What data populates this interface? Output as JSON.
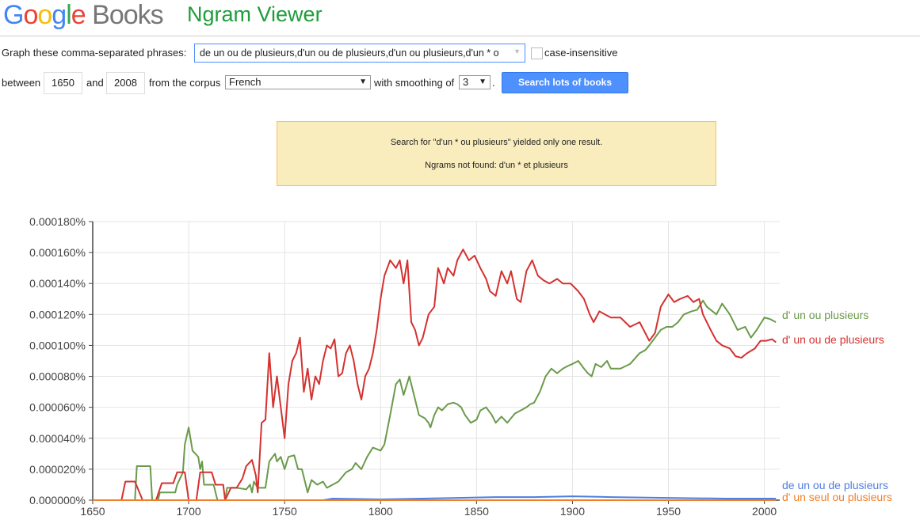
{
  "header": {
    "logo": "Google Books",
    "app_title": "Ngram Viewer"
  },
  "form": {
    "phrases_label": "Graph these comma-separated phrases:",
    "phrases_value": "de un ou de plusieurs,d'un ou de plusieurs,d'un ou plusieurs,d'un * o",
    "case_label": "case-insensitive",
    "case_checked": false,
    "between_label": "between",
    "start_year": "1650",
    "and_label": "and",
    "end_year": "2008",
    "corpus_label": "from the corpus",
    "corpus": "French",
    "smoothing_label": "with smoothing of",
    "smoothing": "3",
    "period": ".",
    "search_button": "Search lots of books"
  },
  "notice": {
    "line1": "Search for \"d'un * ou plusieurs\" yielded only one result.",
    "line2": "Ngrams not found: d'un * et plusieurs"
  },
  "chart_data": {
    "type": "line",
    "xlim": [
      1650,
      2008
    ],
    "ylim": [
      0,
      0.00018
    ],
    "x_ticks": [
      "1650",
      "1700",
      "1750",
      "1800",
      "1850",
      "1900",
      "1950",
      "2000"
    ],
    "y_ticks": [
      "0.000000%",
      "0.000020%",
      "0.000040%",
      "0.000060%",
      "0.000080%",
      "0.000100%",
      "0.000120%",
      "0.000140%",
      "0.000160%",
      "0.000180%"
    ],
    "grid": true,
    "legend": "right, at line ends",
    "series": [
      {
        "name": "d' un ou plusieurs",
        "color": "#6a9a4b",
        "points": [
          [
            1650,
            0
          ],
          [
            1672,
            0
          ],
          [
            1673,
            2.2e-05
          ],
          [
            1680,
            2.2e-05
          ],
          [
            1681,
            0
          ],
          [
            1684,
            0
          ],
          [
            1685,
            5e-06
          ],
          [
            1693,
            5e-06
          ],
          [
            1694,
            1e-05
          ],
          [
            1697,
            1.8e-05
          ],
          [
            1698,
            3.6e-05
          ],
          [
            1700,
            4.7e-05
          ],
          [
            1702,
            3.2e-05
          ],
          [
            1705,
            2.8e-05
          ],
          [
            1706,
            2e-05
          ],
          [
            1707,
            2.5e-05
          ],
          [
            1708,
            1e-05
          ],
          [
            1713,
            1e-05
          ],
          [
            1715,
            0
          ],
          [
            1719,
            0
          ],
          [
            1720,
            8e-06
          ],
          [
            1725,
            8e-06
          ],
          [
            1730,
            7e-06
          ],
          [
            1732,
            1e-05
          ],
          [
            1733,
            5e-06
          ],
          [
            1734,
            1.2e-05
          ],
          [
            1736,
            8e-06
          ],
          [
            1740,
            8e-06
          ],
          [
            1742,
            2.5e-05
          ],
          [
            1745,
            3e-05
          ],
          [
            1746,
            2.5e-05
          ],
          [
            1748,
            2.8e-05
          ],
          [
            1750,
            2e-05
          ],
          [
            1752,
            2.8e-05
          ],
          [
            1755,
            2.9e-05
          ],
          [
            1757,
            2e-05
          ],
          [
            1759,
            2e-05
          ],
          [
            1762,
            5e-06
          ],
          [
            1764,
            1.3e-05
          ],
          [
            1767,
            1e-05
          ],
          [
            1770,
            1.2e-05
          ],
          [
            1772,
            8e-06
          ],
          [
            1775,
            1e-05
          ],
          [
            1778,
            1.2e-05
          ],
          [
            1782,
            1.8e-05
          ],
          [
            1785,
            2e-05
          ],
          [
            1787,
            2.4e-05
          ],
          [
            1790,
            2e-05
          ],
          [
            1793,
            2.8e-05
          ],
          [
            1796,
            3.4e-05
          ],
          [
            1798,
            3.3e-05
          ],
          [
            1800,
            3.2e-05
          ],
          [
            1802,
            3.6e-05
          ],
          [
            1805,
            5.5e-05
          ],
          [
            1808,
            7.5e-05
          ],
          [
            1810,
            7.8e-05
          ],
          [
            1812,
            6.8e-05
          ],
          [
            1815,
            8e-05
          ],
          [
            1817,
            7e-05
          ],
          [
            1820,
            5.5e-05
          ],
          [
            1823,
            5.3e-05
          ],
          [
            1825,
            5e-05
          ],
          [
            1826,
            4.7e-05
          ],
          [
            1828,
            5.5e-05
          ],
          [
            1830,
            6e-05
          ],
          [
            1832,
            5.8e-05
          ],
          [
            1835,
            6.2e-05
          ],
          [
            1838,
            6.3e-05
          ],
          [
            1840,
            6.2e-05
          ],
          [
            1842,
            6e-05
          ],
          [
            1844,
            5.5e-05
          ],
          [
            1847,
            5e-05
          ],
          [
            1850,
            5.2e-05
          ],
          [
            1852,
            5.8e-05
          ],
          [
            1855,
            6e-05
          ],
          [
            1858,
            5.5e-05
          ],
          [
            1860,
            5e-05
          ],
          [
            1863,
            5.4e-05
          ],
          [
            1866,
            5e-05
          ],
          [
            1870,
            5.6e-05
          ],
          [
            1873,
            5.8e-05
          ],
          [
            1876,
            6e-05
          ],
          [
            1878,
            6.2e-05
          ],
          [
            1880,
            6.3e-05
          ],
          [
            1883,
            7e-05
          ],
          [
            1886,
            8e-05
          ],
          [
            1889,
            8.5e-05
          ],
          [
            1892,
            8.2e-05
          ],
          [
            1895,
            8.5e-05
          ],
          [
            1898,
            8.7e-05
          ],
          [
            1900,
            8.8e-05
          ],
          [
            1903,
            9e-05
          ],
          [
            1906,
            8.5e-05
          ],
          [
            1908,
            8.2e-05
          ],
          [
            1910,
            8e-05
          ],
          [
            1912,
            8.8e-05
          ],
          [
            1915,
            8.6e-05
          ],
          [
            1918,
            9e-05
          ],
          [
            1920,
            8.5e-05
          ],
          [
            1925,
            8.5e-05
          ],
          [
            1930,
            8.8e-05
          ],
          [
            1935,
            9.5e-05
          ],
          [
            1938,
            9.7e-05
          ],
          [
            1940,
            0.0001
          ],
          [
            1943,
            0.000105
          ],
          [
            1946,
            0.00011
          ],
          [
            1949,
            0.000112
          ],
          [
            1952,
            0.000112
          ],
          [
            1955,
            0.000115
          ],
          [
            1958,
            0.00012
          ],
          [
            1962,
            0.000122
          ],
          [
            1965,
            0.000123
          ],
          [
            1968,
            0.000129
          ],
          [
            1970,
            0.000125
          ],
          [
            1975,
            0.00012
          ],
          [
            1978,
            0.000127
          ],
          [
            1982,
            0.00012
          ],
          [
            1986,
            0.00011
          ],
          [
            1990,
            0.000112
          ],
          [
            1993,
            0.000105
          ],
          [
            1996,
            0.00011
          ],
          [
            2000,
            0.000118
          ],
          [
            2003,
            0.000117
          ],
          [
            2006,
            0.000115
          ]
        ]
      },
      {
        "name": "d' un ou de plusieurs",
        "color": "#d5312f",
        "points": [
          [
            1650,
            0
          ],
          [
            1665,
            0
          ],
          [
            1667,
            1.2e-05
          ],
          [
            1672,
            1.2e-05
          ],
          [
            1676,
            0
          ],
          [
            1683,
            0
          ],
          [
            1686,
            1.1e-05
          ],
          [
            1692,
            1.1e-05
          ],
          [
            1694,
            1.8e-05
          ],
          [
            1698,
            1.8e-05
          ],
          [
            1700,
            0
          ],
          [
            1704,
            0
          ],
          [
            1706,
            1.8e-05
          ],
          [
            1712,
            1.8e-05
          ],
          [
            1714,
            1e-05
          ],
          [
            1718,
            1e-05
          ],
          [
            1719,
            0
          ],
          [
            1722,
            8e-06
          ],
          [
            1725,
            8e-06
          ],
          [
            1728,
            1.4e-05
          ],
          [
            1730,
            2.2e-05
          ],
          [
            1733,
            2.6e-05
          ],
          [
            1735,
            1.6e-05
          ],
          [
            1736,
            5e-06
          ],
          [
            1738,
            5e-05
          ],
          [
            1740,
            5.2e-05
          ],
          [
            1742,
            9.5e-05
          ],
          [
            1744,
            6e-05
          ],
          [
            1746,
            8e-05
          ],
          [
            1748,
            6e-05
          ],
          [
            1750,
            4e-05
          ],
          [
            1752,
            7.5e-05
          ],
          [
            1754,
            9e-05
          ],
          [
            1756,
            9.5e-05
          ],
          [
            1758,
            0.000105
          ],
          [
            1760,
            7e-05
          ],
          [
            1762,
            8.5e-05
          ],
          [
            1764,
            6.5e-05
          ],
          [
            1766,
            8e-05
          ],
          [
            1768,
            7.5e-05
          ],
          [
            1770,
            9e-05
          ],
          [
            1772,
            0.0001
          ],
          [
            1774,
            9.8e-05
          ],
          [
            1776,
            0.000104
          ],
          [
            1778,
            8e-05
          ],
          [
            1780,
            8.2e-05
          ],
          [
            1782,
            9.5e-05
          ],
          [
            1784,
            0.0001
          ],
          [
            1786,
            9e-05
          ],
          [
            1788,
            7.5e-05
          ],
          [
            1790,
            6.5e-05
          ],
          [
            1792,
            8e-05
          ],
          [
            1794,
            8.5e-05
          ],
          [
            1796,
            9.5e-05
          ],
          [
            1798,
            0.00011
          ],
          [
            1800,
            0.00013
          ],
          [
            1802,
            0.000145
          ],
          [
            1805,
            0.000155
          ],
          [
            1808,
            0.00015
          ],
          [
            1810,
            0.000155
          ],
          [
            1812,
            0.00014
          ],
          [
            1814,
            0.000155
          ],
          [
            1816,
            0.000115
          ],
          [
            1818,
            0.00011
          ],
          [
            1820,
            0.0001
          ],
          [
            1822,
            0.000105
          ],
          [
            1825,
            0.00012
          ],
          [
            1828,
            0.000125
          ],
          [
            1830,
            0.00015
          ],
          [
            1833,
            0.00014
          ],
          [
            1835,
            0.00015
          ],
          [
            1838,
            0.000145
          ],
          [
            1840,
            0.000155
          ],
          [
            1843,
            0.000162
          ],
          [
            1846,
            0.000155
          ],
          [
            1849,
            0.000158
          ],
          [
            1852,
            0.00015
          ],
          [
            1855,
            0.000143
          ],
          [
            1857,
            0.000135
          ],
          [
            1860,
            0.000132
          ],
          [
            1863,
            0.000148
          ],
          [
            1866,
            0.00014
          ],
          [
            1868,
            0.000148
          ],
          [
            1871,
            0.00013
          ],
          [
            1873,
            0.000128
          ],
          [
            1876,
            0.000148
          ],
          [
            1879,
            0.000155
          ],
          [
            1882,
            0.000145
          ],
          [
            1885,
            0.000142
          ],
          [
            1888,
            0.00014
          ],
          [
            1892,
            0.000143
          ],
          [
            1895,
            0.00014
          ],
          [
            1899,
            0.00014
          ],
          [
            1903,
            0.000135
          ],
          [
            1906,
            0.00013
          ],
          [
            1909,
            0.00012
          ],
          [
            1911,
            0.000115
          ],
          [
            1914,
            0.000122
          ],
          [
            1917,
            0.00012
          ],
          [
            1920,
            0.000118
          ],
          [
            1925,
            0.000118
          ],
          [
            1930,
            0.000112
          ],
          [
            1935,
            0.000115
          ],
          [
            1940,
            0.000103
          ],
          [
            1943,
            0.000108
          ],
          [
            1946,
            0.000125
          ],
          [
            1950,
            0.000133
          ],
          [
            1953,
            0.000128
          ],
          [
            1956,
            0.00013
          ],
          [
            1960,
            0.000132
          ],
          [
            1963,
            0.000128
          ],
          [
            1966,
            0.00013
          ],
          [
            1968,
            0.00012
          ],
          [
            1972,
            0.00011
          ],
          [
            1975,
            0.000103
          ],
          [
            1978,
            0.0001
          ],
          [
            1982,
            9.8e-05
          ],
          [
            1985,
            9.3e-05
          ],
          [
            1988,
            9.2e-05
          ],
          [
            1991,
            9.5e-05
          ],
          [
            1995,
            9.8e-05
          ],
          [
            1998,
            0.000103
          ],
          [
            2001,
            0.000103
          ],
          [
            2004,
            0.000104
          ],
          [
            2006,
            0.000102
          ]
        ]
      },
      {
        "name": "de un ou de plusieurs",
        "color": "#4f7de0",
        "points": [
          [
            1650,
            0
          ],
          [
            1770,
            0
          ],
          [
            1775,
            1e-06
          ],
          [
            1800,
            5e-07
          ],
          [
            1840,
            1.5e-06
          ],
          [
            1860,
            2e-06
          ],
          [
            1880,
            2e-06
          ],
          [
            1900,
            2.5e-06
          ],
          [
            1920,
            2e-06
          ],
          [
            1950,
            1.5e-06
          ],
          [
            1980,
            1e-06
          ],
          [
            2006,
            1e-06
          ]
        ]
      },
      {
        "name": "d' un seul ou plusieurs",
        "color": "#f07f2a",
        "points": [
          [
            1650,
            0
          ],
          [
            2006,
            0
          ]
        ]
      }
    ]
  }
}
